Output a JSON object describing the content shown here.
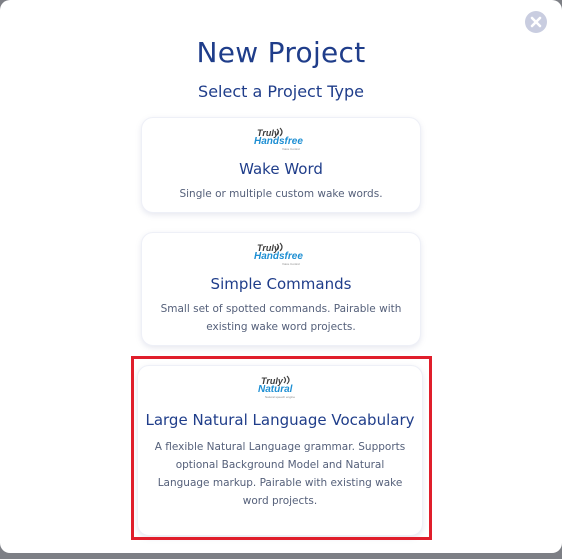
{
  "dialog": {
    "title": "New Project",
    "subtitle": "Select a Project Type",
    "close_icon": "close-icon"
  },
  "project_types": [
    {
      "logo_line1": "Truly",
      "logo_line2": "Handsfree",
      "logo_tagline": "Voice Control",
      "title": "Wake Word",
      "description": "Single or multiple custom wake words."
    },
    {
      "logo_line1": "Truly",
      "logo_line2": "Handsfree",
      "logo_tagline": "Voice Control",
      "title": "Simple Commands",
      "description": "Small set of spotted commands. Pairable with existing wake word projects."
    },
    {
      "logo_line1": "Truly",
      "logo_line2": "Natural",
      "logo_tagline": "Natural speech engine",
      "title": "Large Natural Language Vocabulary",
      "description": "A flexible Natural Language grammar. Supports optional Background Model and Natural Language markup. Pairable with existing wake word projects."
    }
  ],
  "colors": {
    "heading": "#1f3d8a",
    "description": "#55607a",
    "highlight": "#e01e2b",
    "logo_blue": "#1e8fd3",
    "close_bg": "#c9cde0"
  }
}
